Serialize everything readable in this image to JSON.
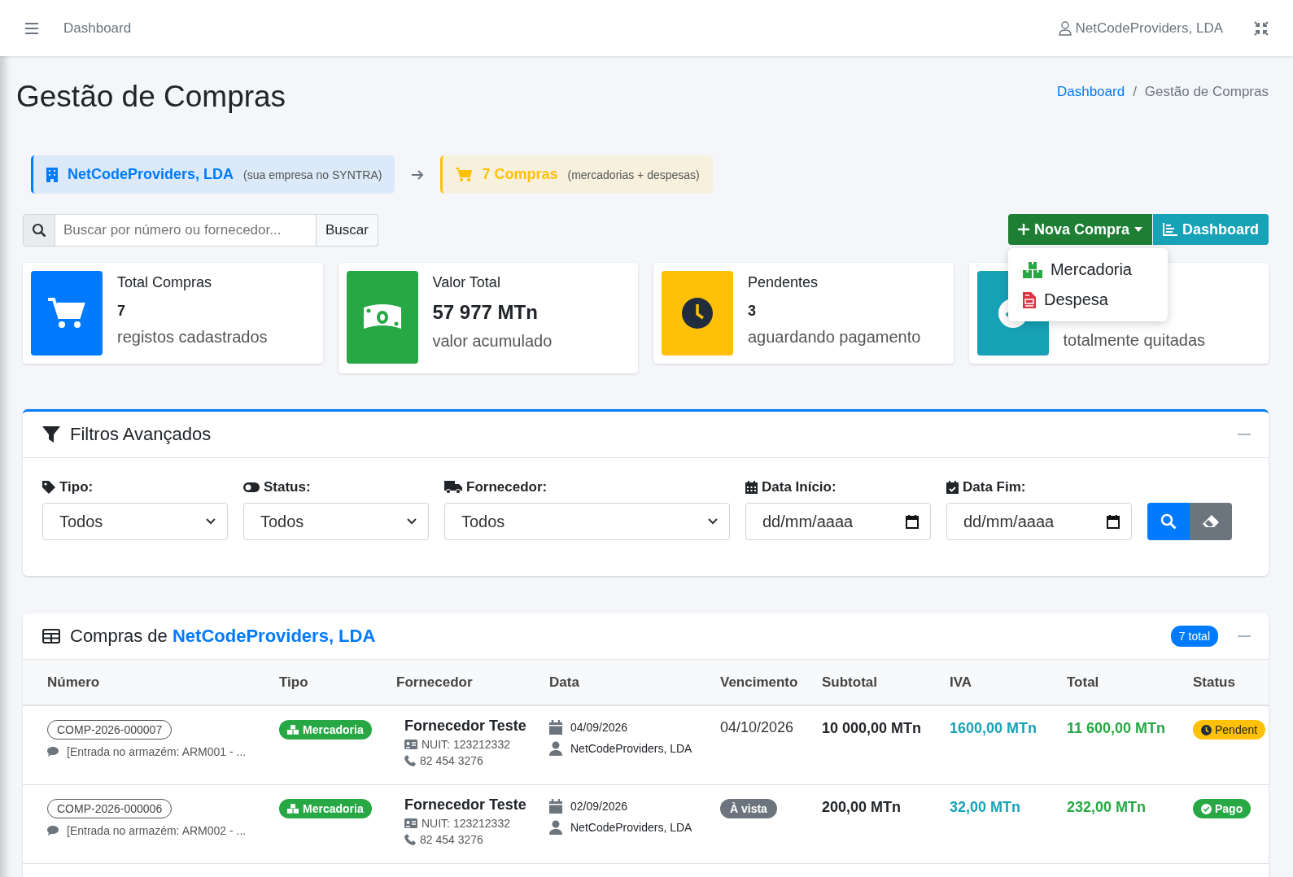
{
  "navbar": {
    "title": "Dashboard",
    "user": "NetCodeProviders, LDA"
  },
  "page": {
    "title": "Gestão de Compras",
    "separator": "/",
    "breadcrumb": [
      {
        "label": "Dashboard",
        "link": true
      },
      {
        "label": "Gestão de Compras",
        "link": false
      }
    ]
  },
  "context": {
    "company": "NetCodeProviders, LDA",
    "company_note": "(sua empresa no SYNTRA)",
    "purchases": "7 Compras",
    "purchases_note": "(mercadorias + despesas)"
  },
  "search": {
    "placeholder": "Buscar por número ou fornecedor...",
    "button": "Buscar"
  },
  "actions": {
    "new": "Nova Compra",
    "dashboard": "Dashboard",
    "menu": [
      {
        "kind": "goods",
        "label": "Mercadoria"
      },
      {
        "kind": "expense",
        "label": "Despesa"
      }
    ]
  },
  "stats": [
    {
      "kind": "cart",
      "color": "#007bff",
      "title": "Total Compras",
      "value": "7",
      "caption": "registos cadastrados"
    },
    {
      "kind": "money",
      "color": "#28a745",
      "title": "Valor Total",
      "value": "57 977 MTn",
      "caption": "valor acumulado"
    },
    {
      "kind": "clock",
      "color": "#ffc107",
      "title": "Pendentes",
      "value": "3",
      "caption": "aguardando pagamento"
    },
    {
      "kind": "check",
      "color": "#17a2b8",
      "caption": "totalmente quitadas"
    }
  ],
  "filters": {
    "title": "Filtros Avançados",
    "fields": [
      {
        "kind": "select",
        "label": "Tipo:",
        "value": "Todos"
      },
      {
        "kind": "select",
        "label": "Status:",
        "value": "Todos"
      },
      {
        "kind": "select",
        "label": "Fornecedor:",
        "value": "Todos"
      },
      {
        "kind": "date",
        "label": "Data Início:",
        "placeholder": "dd/mm/aaaa"
      },
      {
        "kind": "date",
        "label": "Data Fim:",
        "placeholder": "dd/mm/aaaa"
      }
    ]
  },
  "table": {
    "title": "Compras de ",
    "company": "NetCodeProviders, LDA",
    "count": "7 total",
    "columns": [
      "Número",
      "Tipo",
      "Fornecedor",
      "Data",
      "Vencimento",
      "Subtotal",
      "IVA",
      "Total",
      "Status"
    ],
    "rows": [
      {
        "number": "COMP-2026-000007",
        "note": "[Entrada no armazém: ARM001 - ...",
        "type": "Mercadoria",
        "supplier": "Fornecedor Teste",
        "nuit": "NUIT: 123212332",
        "phone": "82 454 3276",
        "date": "04/09/2026",
        "user": "NetCodeProviders, LDA",
        "due": {
          "kind": "date",
          "text": "04/10/2026"
        },
        "subtotal": "10 000,00 MTn",
        "iva": "1600,00 MTn",
        "total": "11 600,00 MTn",
        "status": {
          "kind": "pending",
          "text": "Pendent"
        }
      },
      {
        "number": "COMP-2026-000006",
        "note": "[Entrada no armazém: ARM002 - ...",
        "type": "Mercadoria",
        "supplier": "Fornecedor Teste",
        "nuit": "NUIT: 123212332",
        "phone": "82 454 3276",
        "date": "02/09/2026",
        "user": "NetCodeProviders, LDA",
        "due": {
          "kind": "cash",
          "text": "À vista"
        },
        "subtotal": "200,00 MTn",
        "iva": "32,00 MTn",
        "total": "232,00 MTn",
        "status": {
          "kind": "paid",
          "text": "Pago"
        }
      }
    ]
  }
}
